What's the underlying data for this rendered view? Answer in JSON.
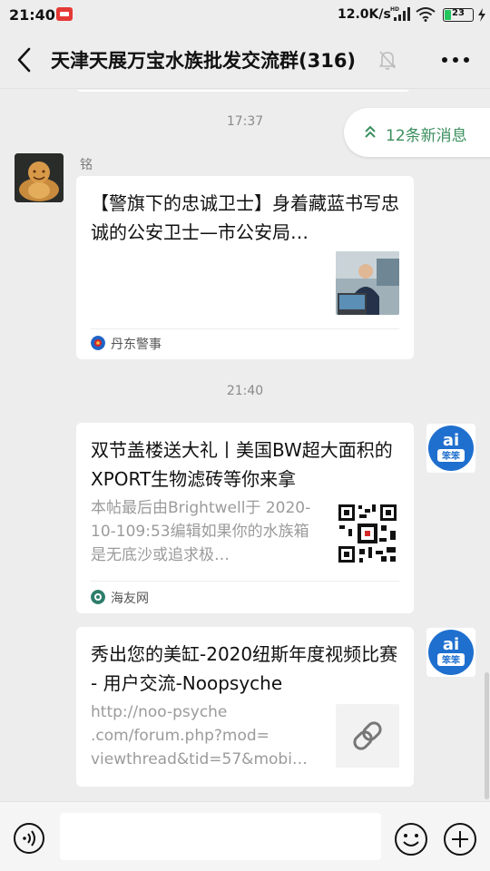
{
  "status_bar": {
    "time": "21:40",
    "net_speed": "12.0K/s",
    "battery_level": "23",
    "battery_color": "#22c55e"
  },
  "header": {
    "title": "天津天展万宝水族批发交流群(316)",
    "back_icon": "chevron-left-icon",
    "mute_icon": "bell-off-icon",
    "more_icon": "more-dots-icon"
  },
  "chat": {
    "new_messages_label": "12条新消息",
    "accent_color": "#3b8f5e",
    "timestamps": [
      "17:37",
      "21:40"
    ],
    "messages": [
      {
        "sender": "铭",
        "title": "【警旗下的忠诚卫士】身着藏蓝书写忠诚的公安卫士—市公安局…",
        "source": "丹东警事",
        "source_color": "#1e63c6"
      },
      {
        "title": "双节盖楼送大礼丨美国BW超大面积的XPORT生物滤砖等你来拿",
        "description": "本帖最后由Brightwell于 2020-10-109:53编辑如果你的水族箱是无底沙或追求极…",
        "source": "海友网",
        "source_color": "#2e7d6b"
      },
      {
        "title": "秀出您的美缸-2020纽斯年度视频比赛 - 用户交流-Noopsyche",
        "description": "http://noo-psyche .com/forum.php?mod= viewthread&tid=57&mobi…"
      }
    ]
  },
  "input_bar": {
    "placeholder": "",
    "voice_icon": "voice-icon",
    "emoji_icon": "emoji-icon",
    "plus_icon": "plus-circle-icon"
  }
}
